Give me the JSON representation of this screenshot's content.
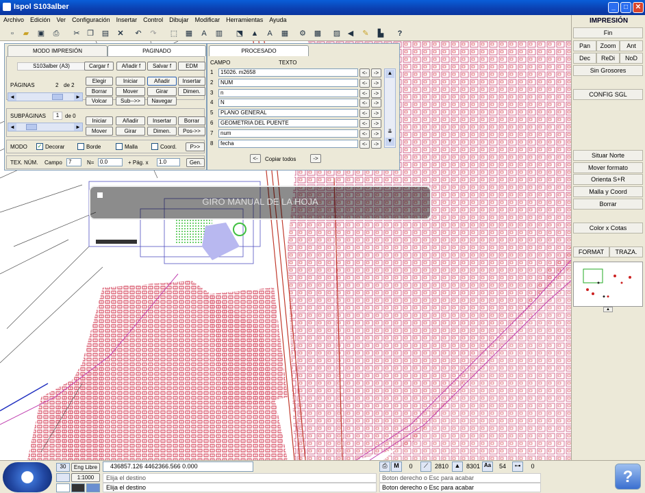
{
  "window": {
    "title": "Ispol  S103alber",
    "btn_min": "_",
    "btn_max": "□",
    "btn_close": "✕"
  },
  "menu": [
    "Archivo",
    "Edición",
    "Ver",
    "Configuración",
    "Insertar",
    "Control",
    "Dibujar",
    "Modificar",
    "Herramientas",
    "Ayuda"
  ],
  "toolbar_icons": [
    "scissors-icon",
    "copy-icon",
    "paste-icon",
    "delete-icon",
    "undo-icon",
    "redo-icon"
  ],
  "print_panel": {
    "tabs": {
      "modo": "MODO IMPRESIÓN",
      "paginado": "PAGINADO"
    },
    "file_label": "S103alber (A3)",
    "top_buttons": [
      "Cargar f",
      "Añadir f",
      "Salvar f",
      "EDM"
    ],
    "paginas_label": "PÁGINAS",
    "page_current": "2",
    "page_of": "de 2",
    "page_buttons_r1": [
      "Elegir",
      "Iniciar",
      "Añadir",
      "Insertar"
    ],
    "page_buttons_r2": [
      "Borrar",
      "Mover",
      "Girar",
      "Dimen."
    ],
    "page_buttons_r3": [
      "Volcar",
      "Sub-->>",
      "Navegar"
    ],
    "subpaginas_label": "SUBPÁGINAS",
    "sub_current": "1",
    "sub_of": "de 0",
    "sub_buttons_r1": [
      "Iniciar",
      "Añadir",
      "Insertar",
      "Borrar"
    ],
    "sub_buttons_r2": [
      "Mover",
      "Girar",
      "Dimen.",
      "Pos->>"
    ],
    "modo_label": "MODO",
    "modo_options": [
      {
        "label": "Decorar",
        "checked": true
      },
      {
        "label": "Borde",
        "checked": false
      },
      {
        "label": "Malla",
        "checked": false
      },
      {
        "label": "Coord.",
        "checked": false
      }
    ],
    "modo_next": "P>>",
    "tex_num_label": "TEX. NÚM.",
    "campo_label": "Campo",
    "campo_value": "7",
    "n_label": "N=",
    "n_value": "0.0",
    "pag_label": "+ Pág. x",
    "pag_value": "1.0",
    "gen_button": "Gen."
  },
  "proc_panel": {
    "tab": "PROCESADO",
    "col_campo": "CAMPO",
    "col_texto": "TEXTO",
    "rows": [
      {
        "n": "1",
        "text": "15026. m2658"
      },
      {
        "n": "2",
        "text": "NUM"
      },
      {
        "n": "3",
        "text": "n"
      },
      {
        "n": "4",
        "text": "N"
      },
      {
        "n": "5",
        "text": "PLANO GENERAL"
      },
      {
        "n": "6",
        "text": "GEOMETRIA DEL PUENTE"
      },
      {
        "n": "7",
        "text": "num"
      },
      {
        "n": "8",
        "text": "fecha"
      }
    ],
    "copy_all": "Copiar todos"
  },
  "overlay_message": "GIRO MANUAL DE LA HOJA",
  "right_panel": {
    "header": "IMPRESIÓN",
    "fin": "Fin",
    "pan": "Pan",
    "zoom": "Zoom",
    "ant": "Ant",
    "dec": "Dec",
    "redi": "ReDi",
    "nod": "NoD",
    "sin_grosores": "Sin Grosores",
    "config_sgl": "CONFIG SGL",
    "situar_norte": "Situar Norte",
    "mover_formato": "Mover formato",
    "orienta": "Orienta S+R",
    "malla_coord": "Malla y Coord",
    "borrar": "Borrar",
    "color_cotas": "Color x Cotas",
    "format": "FORMAT",
    "traza": "TRAZA."
  },
  "status": {
    "scale_num": "30",
    "eng_libre": "Eng Libre",
    "coords": "436857.126  4462366.566      0.000",
    "scale": "1:1000",
    "prompt1": "Elija el destino",
    "prompt2": "Elija el destino",
    "val_m": "0",
    "val_a": "2810",
    "val_b": "8301",
    "val_aa": "54",
    "val_e": "0",
    "hint1": "Boton derecho o Esc para acabar",
    "hint2": "Boton derecho o Esc para acabar"
  },
  "colors": {
    "title_blue": "#0b45c0",
    "map_red": "#cc1f3a",
    "map_magenta": "#c040b0",
    "accent_green": "#3fbf3f"
  }
}
